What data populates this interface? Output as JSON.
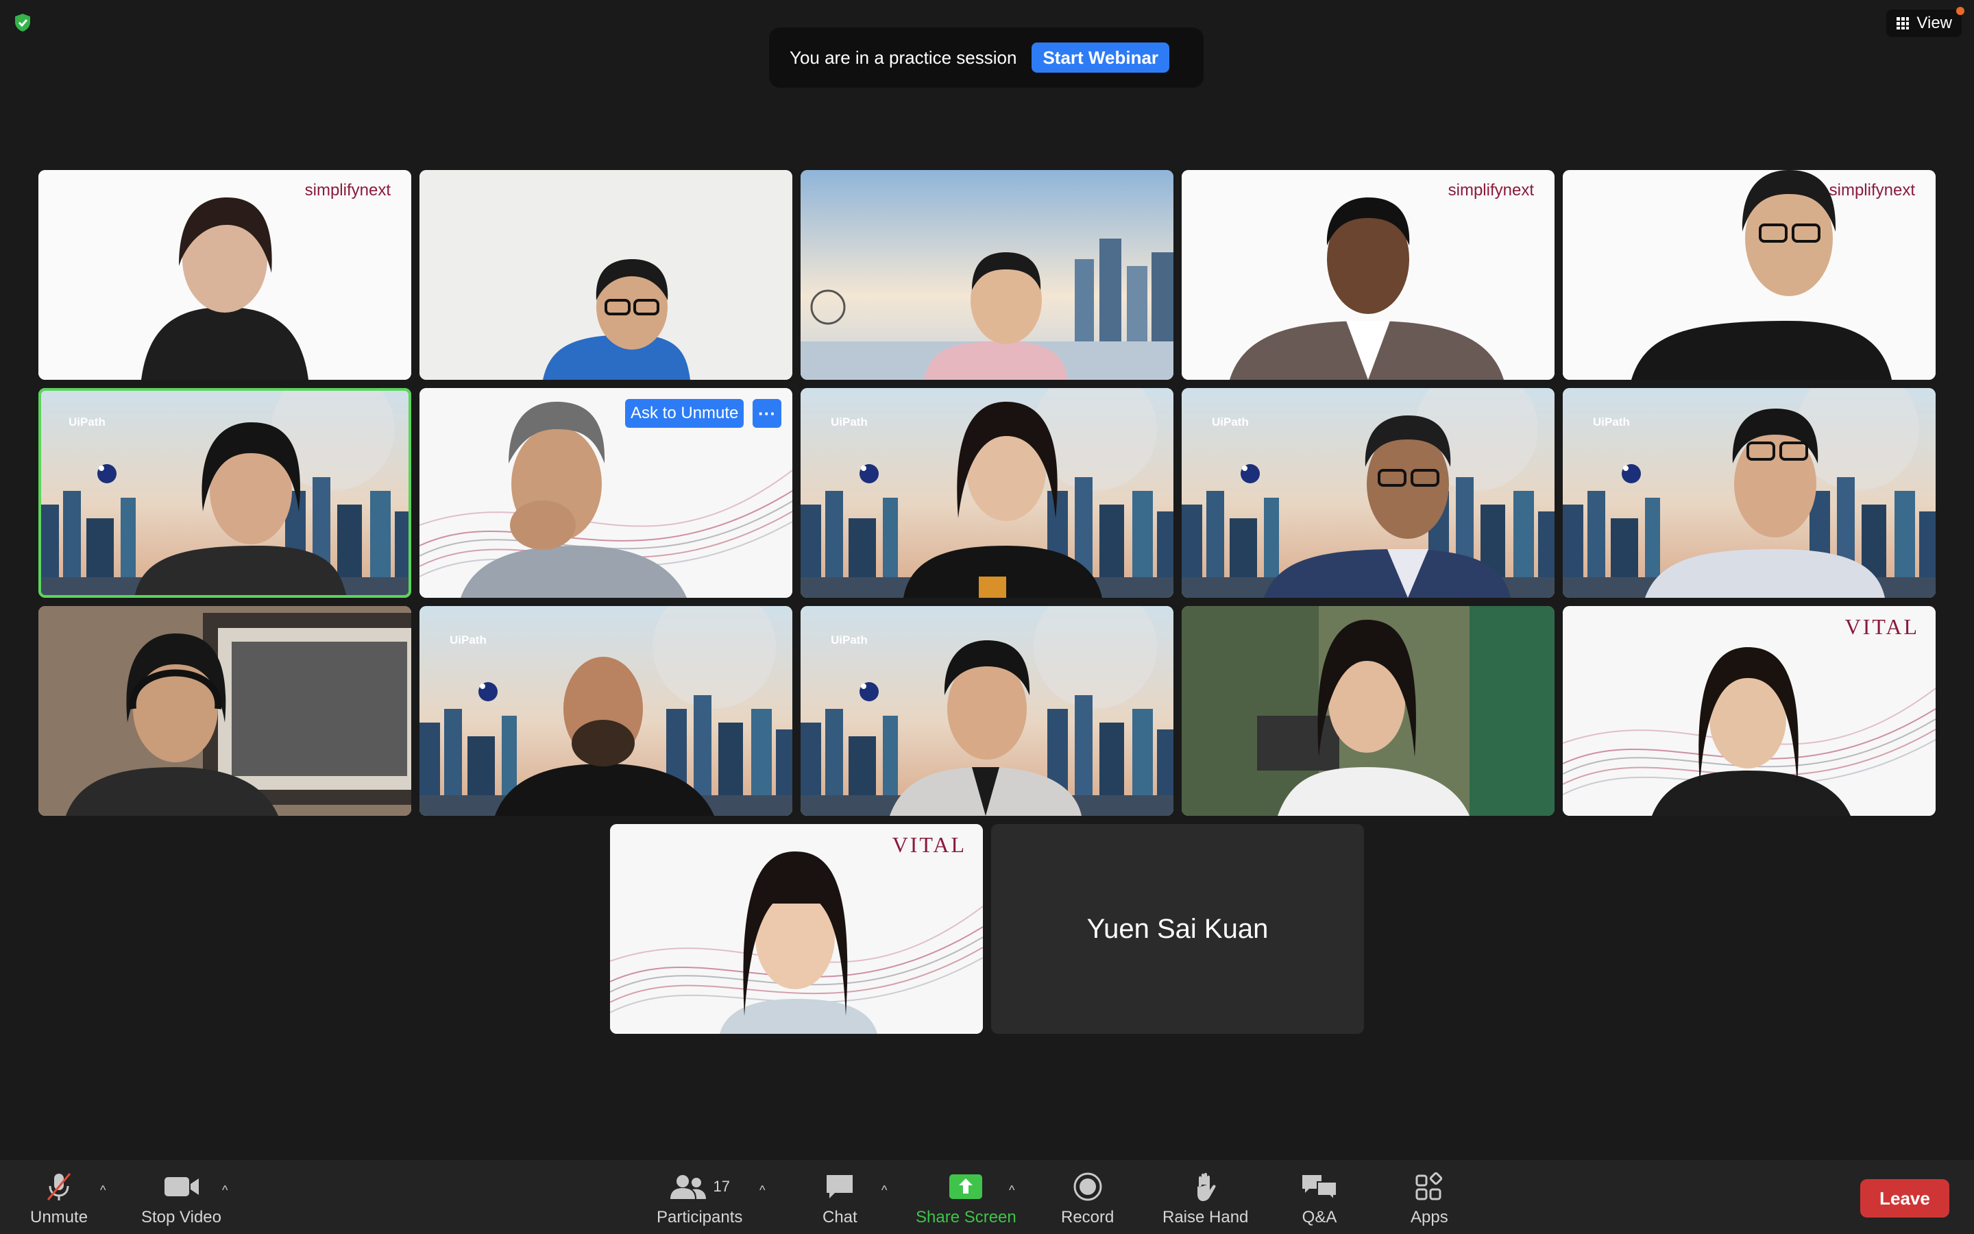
{
  "banner": {
    "text": "You are in a practice session",
    "start_label": "Start Webinar"
  },
  "view": {
    "label": "View"
  },
  "tiles": {
    "t1_brand": "simplifynext",
    "t4_brand": "simplifynext",
    "t5_brand": "simplifynext",
    "t6_brand": "UiPath",
    "t8_brand": "UiPath",
    "t9_brand": "UiPath",
    "t10_brand": "UiPath",
    "t12_brand": "UiPath",
    "t13_brand": "UiPath",
    "t15_brand": "VITAL",
    "t16_brand": "VITAL",
    "name_only": "Yuen Sai Kuan"
  },
  "tile_actions": {
    "ask_to_unmute": "Ask to Unmute",
    "more": "···"
  },
  "toolbar": {
    "unmute": "Unmute",
    "stop_video": "Stop Video",
    "participants": "Participants",
    "participants_count": "17",
    "chat": "Chat",
    "share_screen": "Share Screen",
    "record": "Record",
    "raise_hand": "Raise Hand",
    "qa": "Q&A",
    "apps": "Apps",
    "leave": "Leave"
  },
  "colors": {
    "accent": "#2d7cf6",
    "active_border": "#5bd45b",
    "leave": "#d03535",
    "share_green": "#3fc34a"
  }
}
